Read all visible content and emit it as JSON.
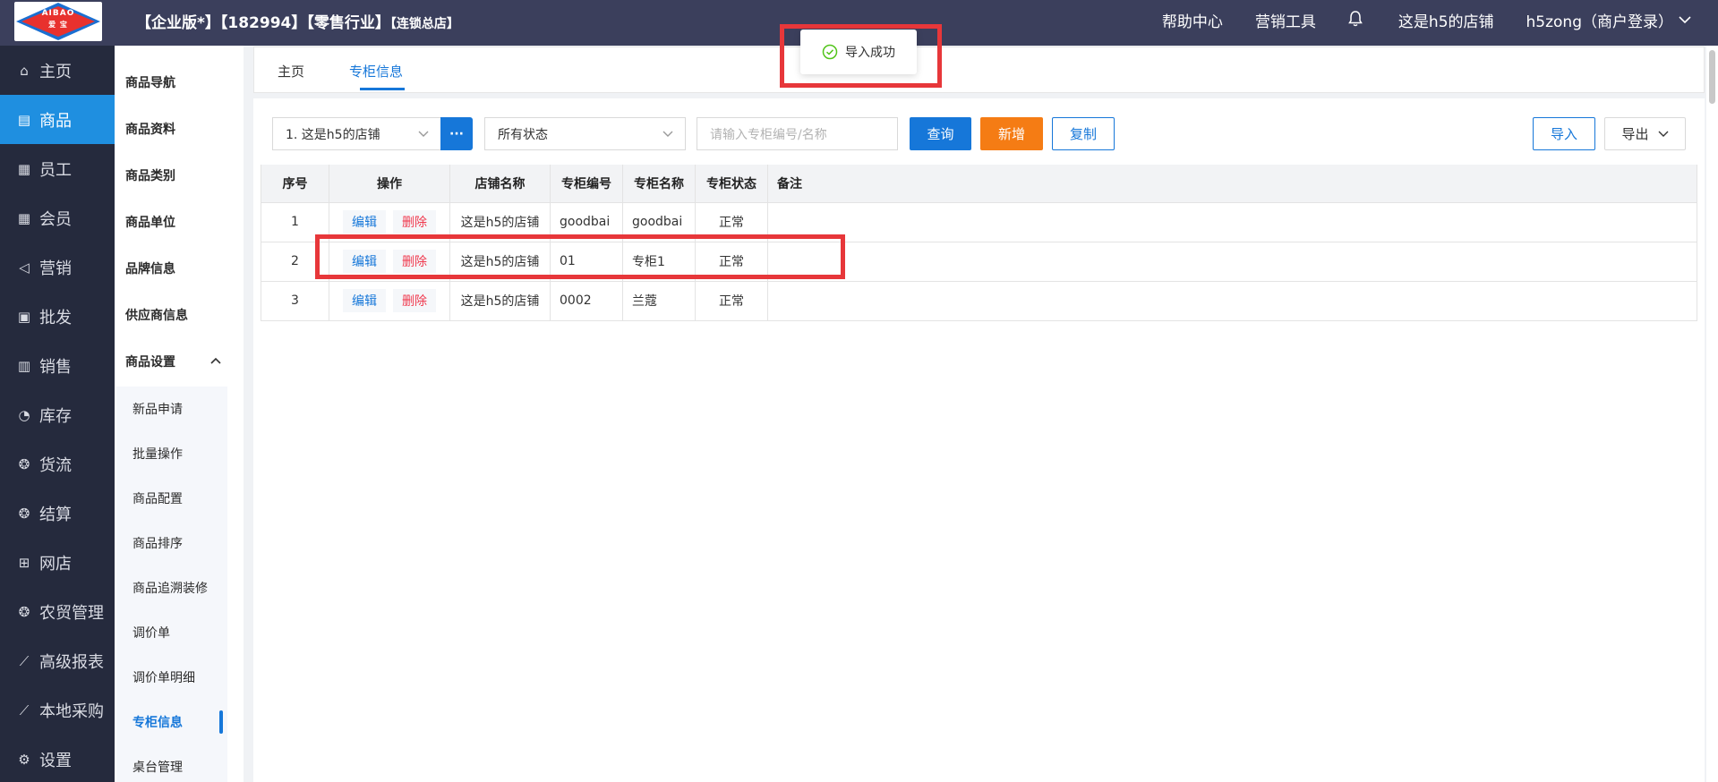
{
  "logo": {
    "line1": "AIBAO",
    "line2": "爱 宝"
  },
  "header": {
    "org_main": "【企业版*】【182994】【零售行业】",
    "org_small": "【连锁总店】",
    "help": "帮助中心",
    "marketing_tools": "营销工具",
    "store": "这是h5的店铺",
    "user": "h5zong（商户登录）"
  },
  "main_nav": [
    {
      "label": "主页",
      "icon": "home-icon"
    },
    {
      "label": "商品",
      "icon": "goods-icon",
      "active": true
    },
    {
      "label": "员工",
      "icon": "staff-icon"
    },
    {
      "label": "会员",
      "icon": "member-icon"
    },
    {
      "label": "营销",
      "icon": "megaphone-icon"
    },
    {
      "label": "批发",
      "icon": "wholesale-icon"
    },
    {
      "label": "销售",
      "icon": "chart-icon"
    },
    {
      "label": "库存",
      "icon": "pie-icon"
    },
    {
      "label": "货流",
      "icon": "flow-icon"
    },
    {
      "label": "结算",
      "icon": "settle-icon"
    },
    {
      "label": "网店",
      "icon": "gift-icon"
    },
    {
      "label": "农贸管理",
      "icon": "farm-icon"
    },
    {
      "label": "高级报表",
      "icon": "report-icon"
    },
    {
      "label": "本地采购",
      "icon": "purchase-icon"
    },
    {
      "label": "设置",
      "icon": "gear-icon"
    }
  ],
  "sub_nav": {
    "items": [
      "商品导航",
      "商品资料",
      "商品类别",
      "商品单位",
      "品牌信息",
      "供应商信息"
    ],
    "group": "商品设置",
    "group_items": [
      "新品申请",
      "批量操作",
      "商品配置",
      "商品排序",
      "商品追溯装修",
      "调价单",
      "调价单明细",
      "专柜信息",
      "桌台管理"
    ]
  },
  "tabs": {
    "home": "主页",
    "current": "专柜信息"
  },
  "filters": {
    "store": "1. 这是h5的店铺",
    "dots": "···",
    "status": "所有状态",
    "search_placeholder": "请输入专柜编号/名称"
  },
  "buttons": {
    "query": "查询",
    "add": "新增",
    "copy": "复制",
    "import": "导入",
    "export": "导出"
  },
  "table": {
    "headers": [
      "序号",
      "操作",
      "店铺名称",
      "专柜编号",
      "专柜名称",
      "专柜状态",
      "备注"
    ],
    "edit": "编辑",
    "delete": "删除",
    "rows": [
      {
        "no": "1",
        "store": "这是h5的店铺",
        "code": "goodbai",
        "name": "goodbai",
        "status": "正常",
        "remark": ""
      },
      {
        "no": "2",
        "store": "这是h5的店铺",
        "code": "01",
        "name": "专柜1",
        "status": "正常",
        "remark": ""
      },
      {
        "no": "3",
        "store": "这是h5的店铺",
        "code": "0002",
        "name": "兰蔻",
        "status": "正常",
        "remark": ""
      }
    ]
  },
  "toast": {
    "message": "导入成功"
  },
  "colors": {
    "topbar": "#3b3f5c",
    "sidebar": "#252a3d",
    "accent": "#1677d9",
    "orange": "#f57c14",
    "highlight": "#e7373a",
    "danger": "#f0394e"
  }
}
